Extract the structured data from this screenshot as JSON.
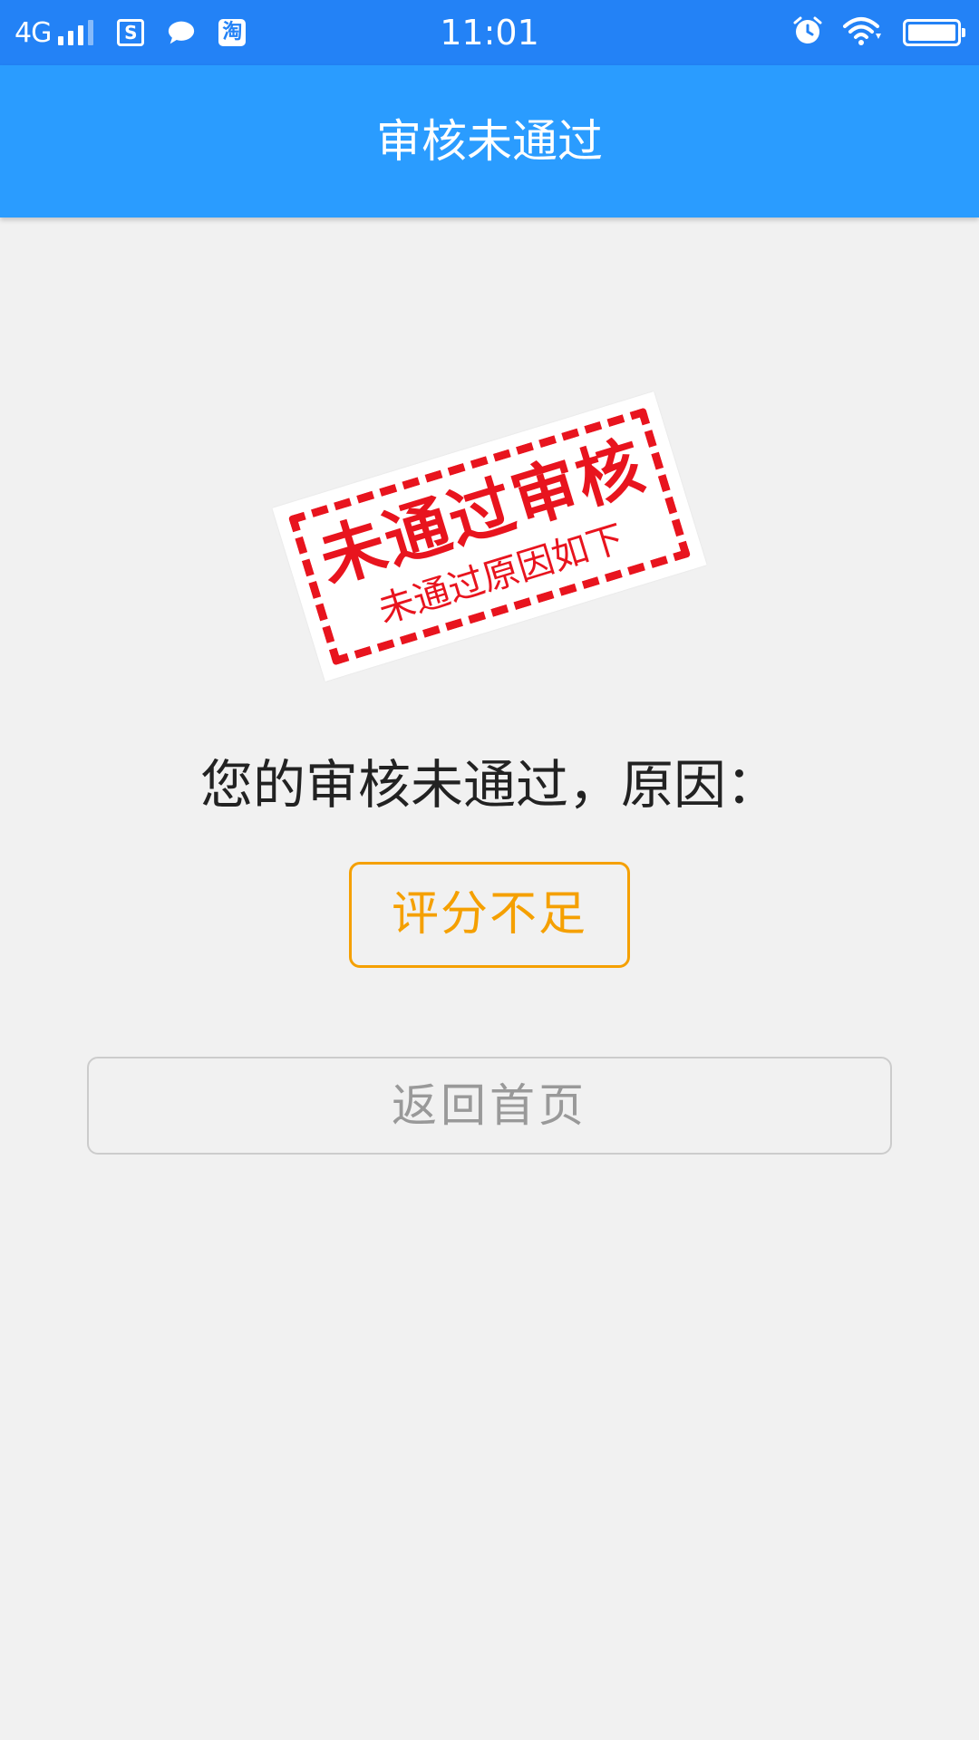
{
  "status_bar": {
    "network": "4G",
    "time": "11:01",
    "app_icons": [
      "s-app-icon",
      "chat-bubble-icon",
      "taobao-icon"
    ],
    "taobao_glyph": "淘",
    "box_glyph": "S",
    "right_icons": [
      "alarm-icon",
      "wifi-icon",
      "battery-icon"
    ]
  },
  "header": {
    "title": "审核未通过"
  },
  "stamp": {
    "line1": "未通过审核",
    "line2": "未通过原因如下"
  },
  "main": {
    "reason_label": "您的审核未通过，原因：",
    "reason_value": "评分不足",
    "home_button_label": "返回首页"
  },
  "colors": {
    "status_bar": "#2382f6",
    "title_bar": "#2a9cff",
    "background": "#f1f1f1",
    "stamp_red": "#e8141e",
    "reason_orange": "#f5a000",
    "button_text": "#999999"
  }
}
